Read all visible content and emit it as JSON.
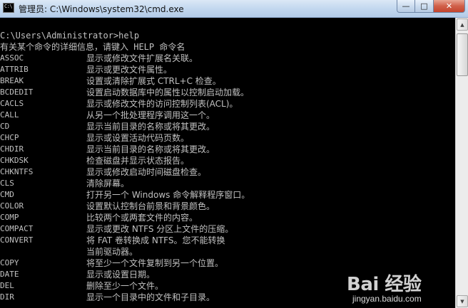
{
  "window": {
    "title": "管理员: C:\\Windows\\system32\\cmd.exe",
    "icon_name": "cmd-app-icon",
    "icon_glyph": "C:\\",
    "controls": {
      "minimize": "—",
      "maximize": "□",
      "close": "✕"
    }
  },
  "console": {
    "prompt": "C:\\Users\\Administrator>help",
    "intro": "有关某个命令的详细信息，请键入 HELP 命令名",
    "commands": [
      {
        "name": "ASSOC",
        "desc": "显示或修改文件扩展名关联。"
      },
      {
        "name": "ATTRIB",
        "desc": "显示或更改文件属性。"
      },
      {
        "name": "BREAK",
        "desc": "设置或清除扩展式 CTRL+C 检查。"
      },
      {
        "name": "BCDEDIT",
        "desc": "设置启动数据库中的属性以控制启动加载。"
      },
      {
        "name": "CACLS",
        "desc": "显示或修改文件的访问控制列表(ACL)。"
      },
      {
        "name": "CALL",
        "desc": "从另一个批处理程序调用这一个。"
      },
      {
        "name": "CD",
        "desc": "显示当前目录的名称或将其更改。"
      },
      {
        "name": "CHCP",
        "desc": "显示或设置活动代码页数。"
      },
      {
        "name": "CHDIR",
        "desc": "显示当前目录的名称或将其更改。"
      },
      {
        "name": "CHKDSK",
        "desc": "检查磁盘并显示状态报告。"
      },
      {
        "name": "CHKNTFS",
        "desc": "显示或修改启动时间磁盘检查。"
      },
      {
        "name": "CLS",
        "desc": "清除屏幕。"
      },
      {
        "name": "CMD",
        "desc": "打开另一个 Windows 命令解释程序窗口。"
      },
      {
        "name": "COLOR",
        "desc": "设置默认控制台前景和背景颜色。"
      },
      {
        "name": "COMP",
        "desc": "比较两个或两套文件的内容。"
      },
      {
        "name": "COMPACT",
        "desc": "显示或更改 NTFS 分区上文件的压缩。"
      },
      {
        "name": "CONVERT",
        "desc": "将 FAT 卷转换成 NTFS。您不能转换"
      },
      {
        "name": "",
        "desc": "当前驱动器。"
      },
      {
        "name": "COPY",
        "desc": "将至少一个文件复制到另一个位置。"
      },
      {
        "name": "DATE",
        "desc": "显示或设置日期。"
      },
      {
        "name": "DEL",
        "desc": "删除至少一个文件。"
      },
      {
        "name": "DIR",
        "desc": "显示一个目录中的文件和子目录。"
      }
    ]
  },
  "watermark": {
    "brand": "Bai 经验",
    "url": "jingyan.baidu.com"
  },
  "colors": {
    "console_bg": "#000000",
    "console_text": "#c0c0c0",
    "titlebar": "#c3d8ef",
    "close_button": "#c4442e"
  }
}
